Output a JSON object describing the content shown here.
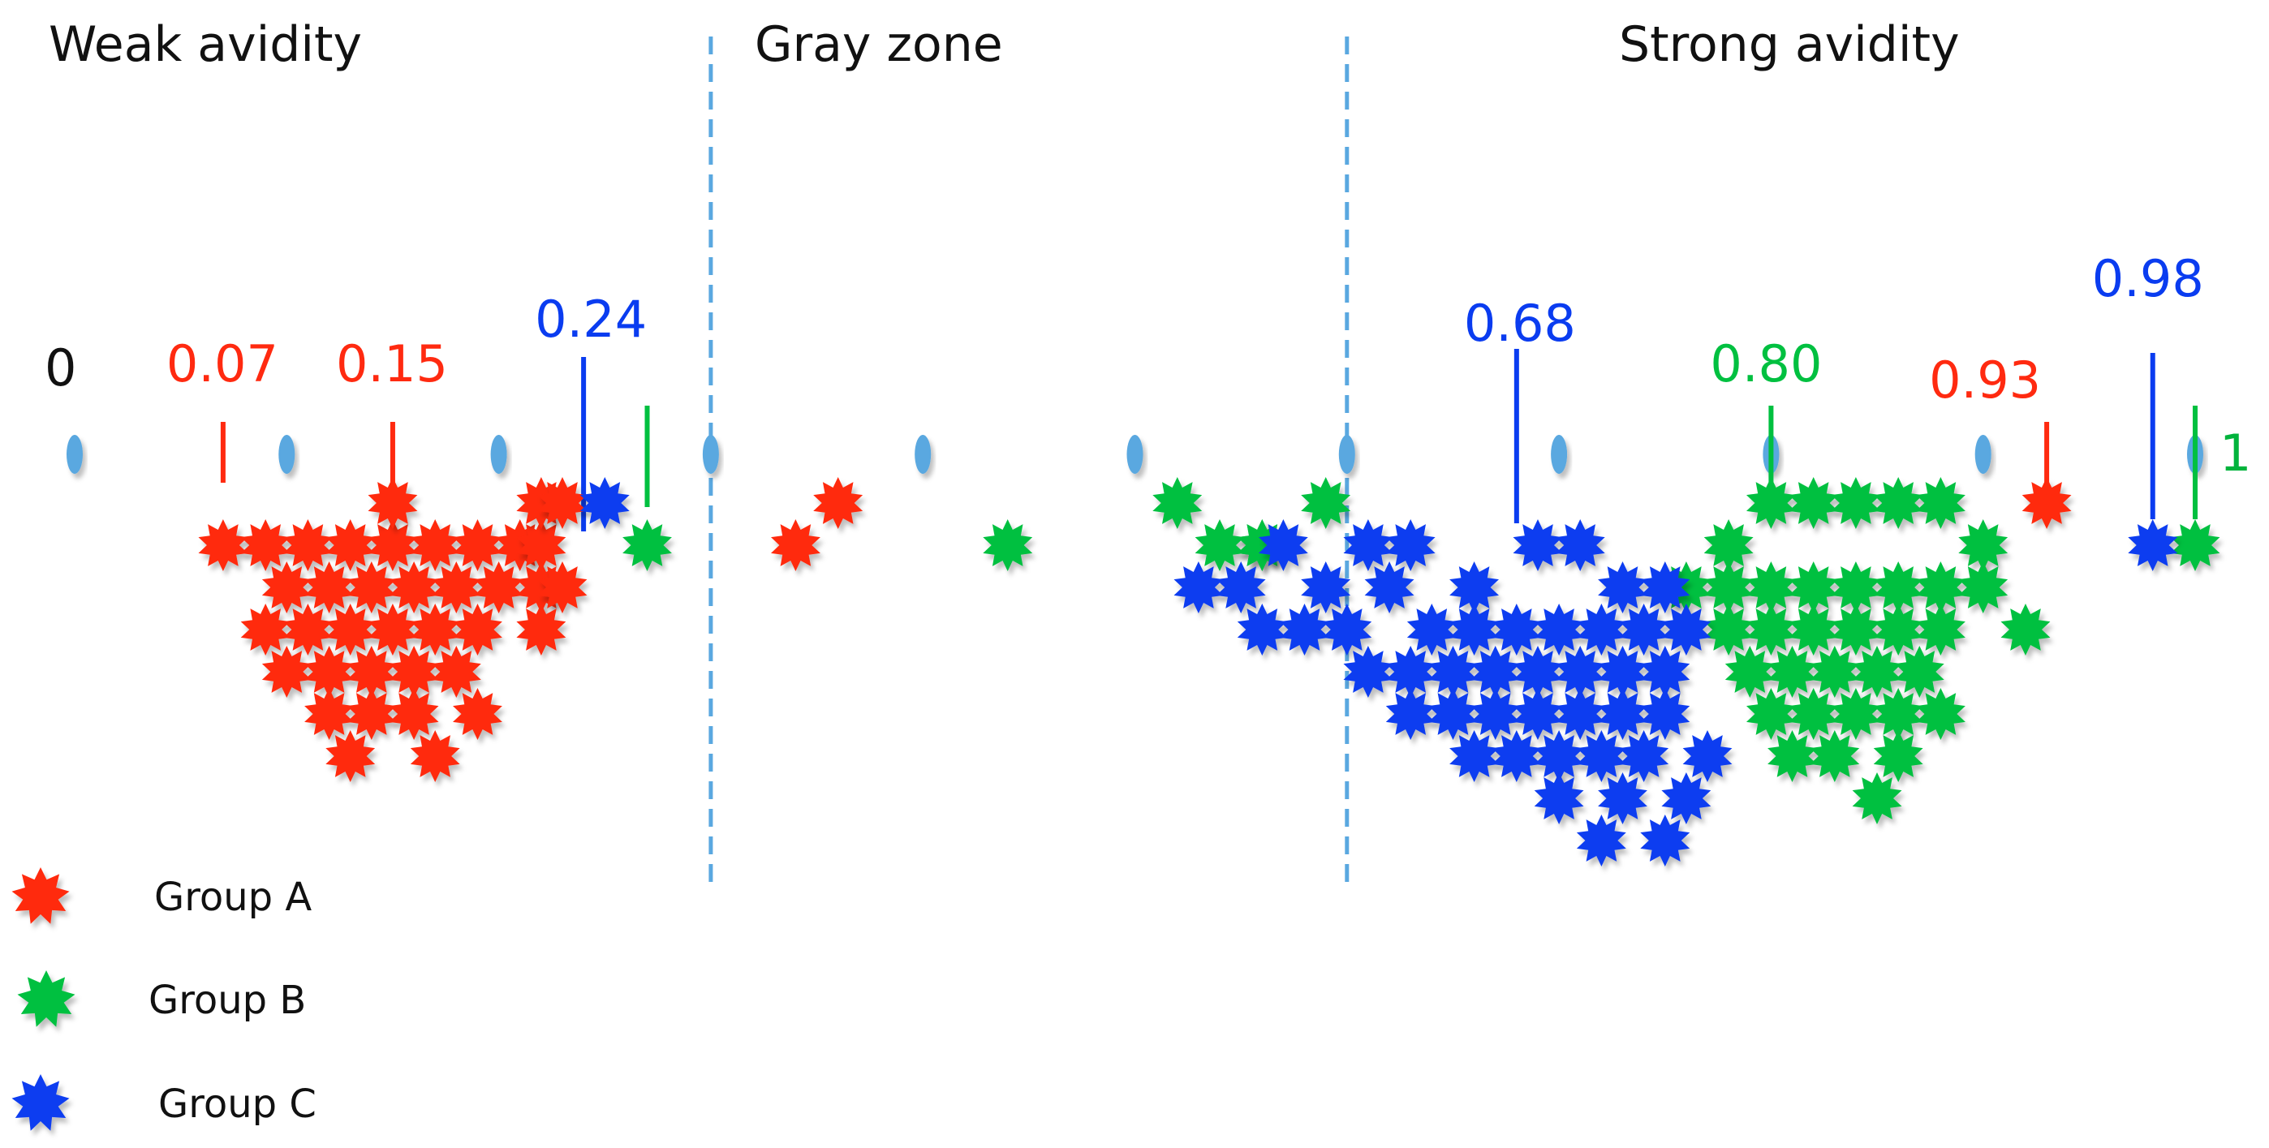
{
  "chart_data": {
    "type": "scatter",
    "title": "",
    "xlabel": "",
    "ylabel": "",
    "xlim": [
      0,
      1
    ],
    "axis_tick_step": 0.1,
    "axis_end_labels": [
      {
        "value": 0,
        "text": "0",
        "color": "#111111"
      },
      {
        "value": 1,
        "text": "1",
        "color": "#00b33c"
      }
    ],
    "zones": [
      {
        "label": "Weak avidity",
        "from": 0,
        "to": 0.3
      },
      {
        "label": "Gray zone",
        "from": 0.3,
        "to": 0.6
      },
      {
        "label": "Strong avidity",
        "from": 0.6,
        "to": 1
      }
    ],
    "zone_boundaries": [
      0.3,
      0.6
    ],
    "markers": [
      {
        "value": 0.07,
        "text": "0.07",
        "series": "Group A"
      },
      {
        "value": 0.15,
        "text": "0.15",
        "series": "Group A"
      },
      {
        "value": 0.24,
        "text": "0.24",
        "series": "Group C"
      },
      {
        "value": 0.27,
        "text": "",
        "series": "Group B"
      },
      {
        "value": 0.68,
        "text": "0.68",
        "series": "Group C"
      },
      {
        "value": 0.8,
        "text": "0.80",
        "series": "Group B"
      },
      {
        "value": 0.93,
        "text": "0.93",
        "series": "Group A"
      },
      {
        "value": 0.98,
        "text": "0.98",
        "series": "Group C"
      },
      {
        "value": 1.0,
        "text": "",
        "series": "Group B"
      }
    ],
    "series": [
      {
        "name": "Group A",
        "color": "#ff2a10",
        "points": [
          [
            0.07,
            1
          ],
          [
            0.09,
            1
          ],
          [
            0.11,
            1
          ],
          [
            0.13,
            1
          ],
          [
            0.15,
            1
          ],
          [
            0.17,
            1
          ],
          [
            0.19,
            1
          ],
          [
            0.21,
            1
          ],
          [
            0.22,
            1
          ],
          [
            0.1,
            2
          ],
          [
            0.12,
            2
          ],
          [
            0.14,
            2
          ],
          [
            0.16,
            2
          ],
          [
            0.18,
            2
          ],
          [
            0.2,
            2
          ],
          [
            0.09,
            3
          ],
          [
            0.11,
            3
          ],
          [
            0.13,
            3
          ],
          [
            0.15,
            3
          ],
          [
            0.17,
            3
          ],
          [
            0.19,
            3
          ],
          [
            0.1,
            4
          ],
          [
            0.12,
            4
          ],
          [
            0.14,
            4
          ],
          [
            0.16,
            4
          ],
          [
            0.18,
            4
          ],
          [
            0.12,
            5
          ],
          [
            0.14,
            5
          ],
          [
            0.16,
            5
          ],
          [
            0.19,
            5
          ],
          [
            0.13,
            6
          ],
          [
            0.17,
            6
          ],
          [
            0.15,
            0
          ],
          [
            0.22,
            0
          ],
          [
            0.23,
            0
          ],
          [
            0.22,
            2
          ],
          [
            0.23,
            2
          ],
          [
            0.22,
            3
          ],
          [
            0.34,
            1
          ],
          [
            0.36,
            0
          ],
          [
            0.93,
            0
          ]
        ]
      },
      {
        "name": "Group B",
        "color": "#00c040",
        "points": [
          [
            0.27,
            1
          ],
          [
            0.44,
            1
          ],
          [
            0.52,
            0
          ],
          [
            0.54,
            1
          ],
          [
            0.56,
            1
          ],
          [
            0.59,
            0
          ],
          [
            0.56,
            1
          ],
          [
            0.78,
            1
          ],
          [
            0.8,
            0
          ],
          [
            0.82,
            0
          ],
          [
            0.84,
            0
          ],
          [
            0.86,
            0
          ],
          [
            0.88,
            0
          ],
          [
            0.9,
            1
          ],
          [
            0.76,
            2
          ],
          [
            0.78,
            2
          ],
          [
            0.8,
            2
          ],
          [
            0.82,
            2
          ],
          [
            0.84,
            2
          ],
          [
            0.86,
            2
          ],
          [
            0.88,
            2
          ],
          [
            0.9,
            2
          ],
          [
            0.92,
            3
          ],
          [
            0.78,
            3
          ],
          [
            0.8,
            3
          ],
          [
            0.82,
            3
          ],
          [
            0.84,
            3
          ],
          [
            0.86,
            3
          ],
          [
            0.88,
            3
          ],
          [
            0.79,
            4
          ],
          [
            0.81,
            4
          ],
          [
            0.83,
            4
          ],
          [
            0.85,
            4
          ],
          [
            0.87,
            4
          ],
          [
            0.8,
            5
          ],
          [
            0.82,
            5
          ],
          [
            0.84,
            5
          ],
          [
            0.86,
            5
          ],
          [
            0.88,
            5
          ],
          [
            0.81,
            6
          ],
          [
            0.83,
            6
          ],
          [
            0.86,
            6
          ],
          [
            0.85,
            7
          ],
          [
            1.0,
            1
          ]
        ]
      },
      {
        "name": "Group C",
        "color": "#0a3cf0",
        "points": [
          [
            0.25,
            0
          ],
          [
            0.53,
            2
          ],
          [
            0.55,
            2
          ],
          [
            0.57,
            1
          ],
          [
            0.59,
            2
          ],
          [
            0.61,
            1
          ],
          [
            0.63,
            1
          ],
          [
            0.66,
            2
          ],
          [
            0.69,
            1
          ],
          [
            0.71,
            1
          ],
          [
            0.73,
            2
          ],
          [
            0.75,
            2
          ],
          [
            0.56,
            3
          ],
          [
            0.58,
            3
          ],
          [
            0.6,
            3
          ],
          [
            0.62,
            2
          ],
          [
            0.64,
            3
          ],
          [
            0.66,
            3
          ],
          [
            0.68,
            3
          ],
          [
            0.7,
            3
          ],
          [
            0.72,
            3
          ],
          [
            0.74,
            3
          ],
          [
            0.76,
            3
          ],
          [
            0.61,
            4
          ],
          [
            0.63,
            4
          ],
          [
            0.65,
            4
          ],
          [
            0.67,
            4
          ],
          [
            0.69,
            4
          ],
          [
            0.71,
            4
          ],
          [
            0.73,
            4
          ],
          [
            0.75,
            4
          ],
          [
            0.63,
            5
          ],
          [
            0.65,
            5
          ],
          [
            0.67,
            5
          ],
          [
            0.69,
            5
          ],
          [
            0.71,
            5
          ],
          [
            0.73,
            5
          ],
          [
            0.75,
            5
          ],
          [
            0.66,
            6
          ],
          [
            0.68,
            6
          ],
          [
            0.7,
            6
          ],
          [
            0.72,
            6
          ],
          [
            0.74,
            6
          ],
          [
            0.77,
            6
          ],
          [
            0.7,
            7
          ],
          [
            0.73,
            7
          ],
          [
            0.76,
            7
          ],
          [
            0.72,
            8
          ],
          [
            0.75,
            8
          ],
          [
            0.98,
            1
          ]
        ]
      }
    ],
    "legend": {
      "placement": "bottom-left",
      "entries": [
        "Group A",
        "Group B",
        "Group C"
      ]
    }
  },
  "colors": {
    "axis": "#4a90c8",
    "axis_tick": "#5aa8e0",
    "boundary": "#5aa8e0"
  }
}
